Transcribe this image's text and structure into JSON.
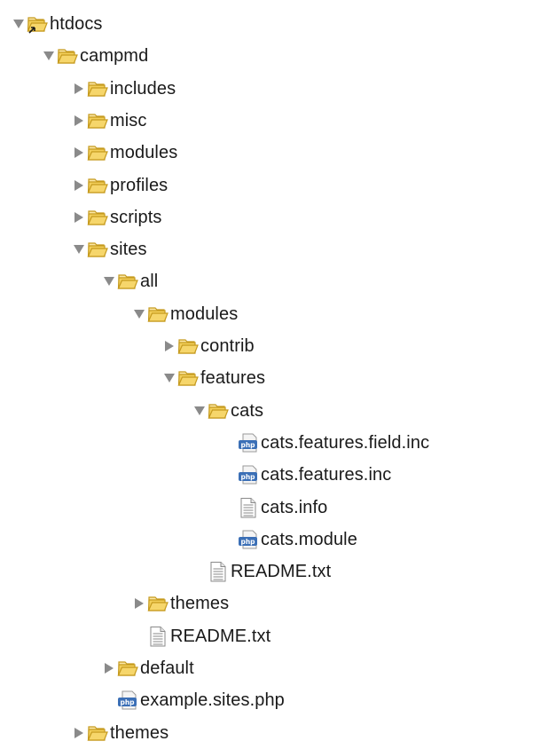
{
  "tree": {
    "items": [
      {
        "label": "htdocs",
        "type": "folder",
        "state": "expanded",
        "link_overlay": true
      },
      {
        "label": "campmd",
        "type": "folder",
        "state": "expanded"
      },
      {
        "label": "includes",
        "type": "folder",
        "state": "collapsed"
      },
      {
        "label": "misc",
        "type": "folder",
        "state": "collapsed"
      },
      {
        "label": "modules",
        "type": "folder",
        "state": "collapsed"
      },
      {
        "label": "profiles",
        "type": "folder",
        "state": "collapsed"
      },
      {
        "label": "scripts",
        "type": "folder",
        "state": "collapsed"
      },
      {
        "label": "sites",
        "type": "folder",
        "state": "expanded"
      },
      {
        "label": "all",
        "type": "folder",
        "state": "expanded"
      },
      {
        "label": "modules",
        "type": "folder",
        "state": "expanded"
      },
      {
        "label": "contrib",
        "type": "folder",
        "state": "collapsed"
      },
      {
        "label": "features",
        "type": "folder",
        "state": "expanded"
      },
      {
        "label": "cats",
        "type": "folder",
        "state": "expanded"
      },
      {
        "label": "cats.features.field.inc",
        "type": "php"
      },
      {
        "label": "cats.features.inc",
        "type": "php"
      },
      {
        "label": "cats.info",
        "type": "text"
      },
      {
        "label": "cats.module",
        "type": "php"
      },
      {
        "label": "README.txt",
        "type": "text"
      },
      {
        "label": "themes",
        "type": "folder",
        "state": "collapsed"
      },
      {
        "label": "README.txt",
        "type": "text"
      },
      {
        "label": "default",
        "type": "folder",
        "state": "collapsed"
      },
      {
        "label": "example.sites.php",
        "type": "php"
      },
      {
        "label": "themes",
        "type": "folder",
        "state": "collapsed"
      }
    ]
  },
  "icons": {
    "folder": "folder-open-icon",
    "php": "php-file-icon",
    "text": "text-file-icon",
    "expanded": "triangle-down-icon",
    "collapsed": "triangle-right-icon"
  },
  "colors": {
    "folder_fill": "#f6d66b",
    "folder_stroke": "#c59a1e",
    "php_blue": "#3b6fb6",
    "twisty": "#8a8a8a",
    "text": "#1a1a1a"
  }
}
